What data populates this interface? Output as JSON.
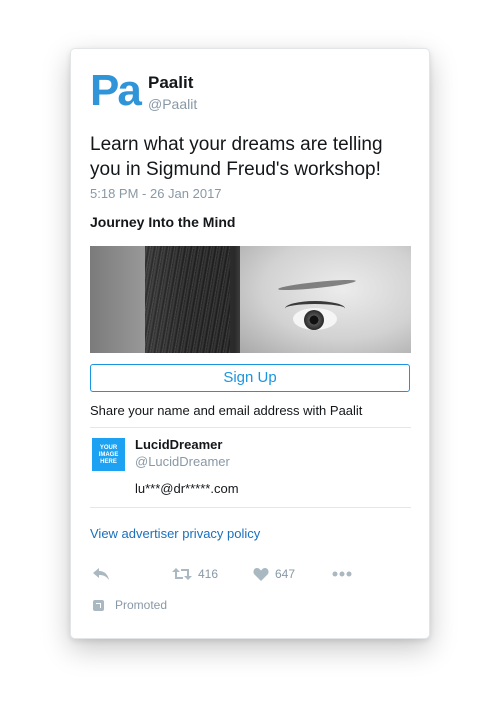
{
  "account": {
    "logo_text": "Pa",
    "name": "Paalit",
    "handle": "@Paalit"
  },
  "tweet": {
    "text": "Learn what your dreams are telling you in Sigmund Freud's workshop!",
    "timestamp": "5:18 PM - 26 Jan 2017"
  },
  "card": {
    "title": "Journey Into the Mind",
    "image_icon": "eye-photo",
    "button_label": "Sign Up",
    "share_note": "Share your name and email address with Paalit"
  },
  "user": {
    "avatar_text": "YOUR IMAGE HERE",
    "name": "LucidDreamer",
    "handle": "@LucidDreamer",
    "email": "lu***@dr*****.com"
  },
  "privacy_link": "View advertiser privacy policy",
  "actions": {
    "reply_icon": "reply-icon",
    "retweet_icon": "retweet-icon",
    "retweets": "416",
    "like_icon": "heart-icon",
    "likes": "647",
    "more_icon": "more-icon"
  },
  "promoted_label": "Promoted",
  "colors": {
    "brand": "#2f95d8",
    "link": "#1b95e0",
    "muted": "#8899a6"
  }
}
